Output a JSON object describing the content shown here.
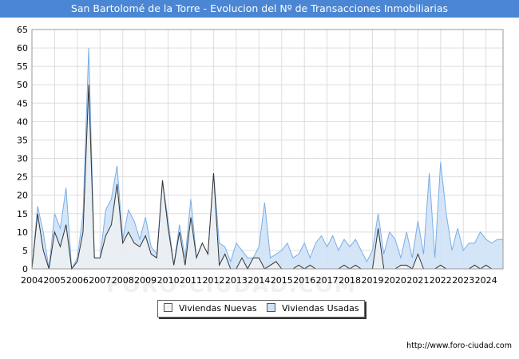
{
  "source_url": "http://www.foro-ciudad.com",
  "watermark": "FORO-CIUDAD.COM",
  "colors": {
    "title_bg": "#4a86d3",
    "nuevas_fill": "#f2f2f2",
    "nuevas_line": "#333333",
    "usadas_fill": "#cfe2f7",
    "usadas_line": "#7aaee6",
    "grid": "#dddddd"
  },
  "chart_data": {
    "type": "area",
    "title": "San Bartolomé de la Torre - Evolucion del Nº de Transacciones Inmobiliarias",
    "xlabel": "",
    "ylabel": "",
    "ylim": [
      0,
      65
    ],
    "yticks": [
      0,
      5,
      10,
      15,
      20,
      25,
      30,
      35,
      40,
      45,
      50,
      55,
      60,
      65
    ],
    "xlim": [
      2004.0,
      2024.75
    ],
    "xticks": [
      "2004",
      "2005",
      "2006",
      "2007",
      "2008",
      "2009",
      "2010",
      "2011",
      "2012",
      "2013",
      "2014",
      "2015",
      "2016",
      "2017",
      "2018",
      "2019",
      "2020",
      "2021",
      "2022",
      "2023",
      "2024"
    ],
    "x_start_year": 2004,
    "periods": "quarterly",
    "grid": true,
    "legend_position": "bottom",
    "series": [
      {
        "name": "Viviendas Nuevas",
        "values": [
          0,
          15,
          5,
          0,
          10,
          6,
          12,
          0,
          2,
          10,
          50,
          3,
          3,
          9,
          12,
          23,
          7,
          10,
          7,
          6,
          9,
          4,
          3,
          24,
          11,
          1,
          10,
          1,
          14,
          3,
          7,
          4,
          26,
          1,
          4,
          0,
          0,
          3,
          0,
          3,
          3,
          0,
          1,
          2,
          0,
          0,
          0,
          1,
          0,
          1,
          0,
          0,
          0,
          0,
          0,
          1,
          0,
          1,
          0,
          0,
          0,
          11,
          0,
          0,
          0,
          1,
          1,
          0,
          4,
          0,
          0,
          0,
          1,
          0,
          0,
          0,
          0,
          0,
          1,
          0,
          1,
          0,
          0,
          0
        ]
      },
      {
        "name": "Viviendas Usadas",
        "values": [
          0,
          17,
          10,
          0,
          15,
          11,
          22,
          0,
          3,
          15,
          60,
          3,
          3,
          16,
          19,
          28,
          8,
          16,
          13,
          8,
          14,
          6,
          4,
          24,
          13,
          1,
          12,
          3,
          19,
          3,
          7,
          4,
          26,
          7,
          6,
          2,
          7,
          5,
          3,
          3,
          6,
          18,
          3,
          4,
          5,
          7,
          3,
          4,
          7,
          3,
          7,
          9,
          6,
          9,
          5,
          8,
          6,
          8,
          5,
          2,
          5,
          15,
          4,
          10,
          8,
          3,
          10,
          3,
          13,
          4,
          26,
          3,
          29,
          15,
          5,
          11,
          5,
          7,
          7,
          10,
          8,
          7,
          8,
          8
        ]
      }
    ]
  }
}
